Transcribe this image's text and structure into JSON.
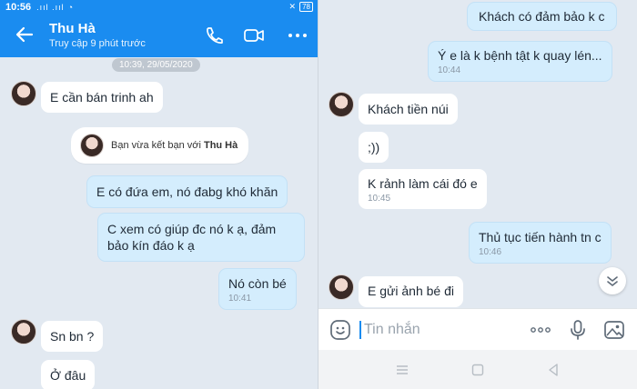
{
  "status_bar": {
    "time": "10:56",
    "signal": ".ııl .ııl",
    "battery": "78"
  },
  "header": {
    "title": "Thu Hà",
    "subtitle": "Truy cập 9 phút trước"
  },
  "left_panel": {
    "timestamp": "10:39, 29/05/2020",
    "messages": [
      {
        "side": "in",
        "text": "E cần bán trinh ah"
      },
      {
        "side": "out",
        "text": "E có đứa em, nó đabg khó khăn"
      },
      {
        "side": "out",
        "text_line1": "C xem có giúp đc nó k ạ, đảm",
        "text_line2": "bảo kín đáo k ạ"
      },
      {
        "side": "out",
        "text": "Nó còn bé",
        "time": "10:41"
      },
      {
        "side": "in",
        "text": "Sn bn ?"
      },
      {
        "side": "in",
        "text": "Ở đâu"
      }
    ],
    "system_notice": {
      "prefix": "Bạn vừa kết bạn với",
      "name": "Thu Hà"
    }
  },
  "right_panel": {
    "messages": [
      {
        "side": "out",
        "text": "Khách có đảm bảo k c"
      },
      {
        "side": "out",
        "text": "Ý e là k bệnh tật k quay lén...",
        "time": "10:44"
      },
      {
        "side": "in",
        "text": "Khách tiền núi"
      },
      {
        "side": "in",
        "text": ";))"
      },
      {
        "side": "in",
        "text": "K rảnh làm cái đó e",
        "time": "10:45"
      },
      {
        "side": "out",
        "text": "Thủ tục tiến hành tn c",
        "time": "10:46"
      },
      {
        "side": "in",
        "text": "E gửi ảnh bé đi"
      }
    ],
    "composer": {
      "placeholder": "Tin nhắn"
    }
  },
  "icons": [
    "back-arrow-icon",
    "phone-icon",
    "video-call-icon",
    "more-icon",
    "emoji-icon",
    "more-dots-icon",
    "microphone-icon",
    "image-icon",
    "chevron-down-icon",
    "menu-icon",
    "home-icon",
    "back-nav-icon"
  ],
  "colors": {
    "accent": "#1a8cf0",
    "outgoing_bubble": "#d4edfd",
    "incoming_bubble": "#ffffff",
    "background": "#e2e9f1"
  }
}
